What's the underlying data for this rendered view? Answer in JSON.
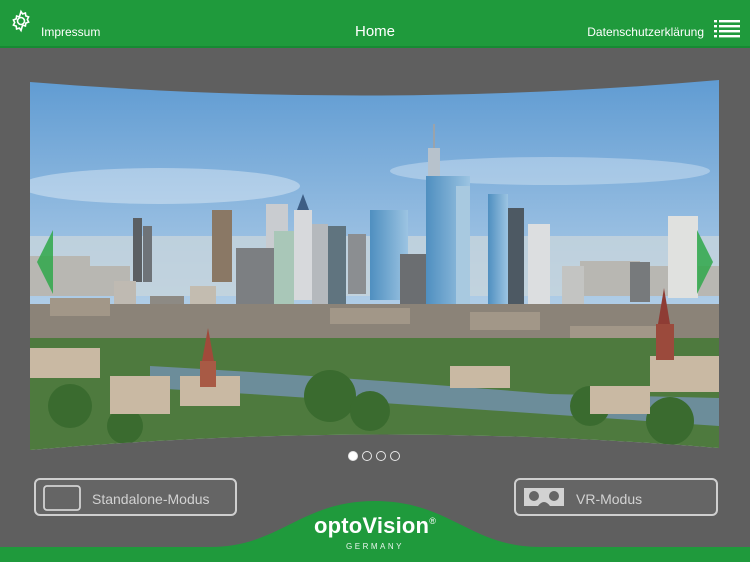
{
  "header": {
    "impressum_label": "Impressum",
    "title": "Home",
    "privacy_label": "Datenschutzerklärung",
    "settings_icon": "gear-icon",
    "menu_icon": "list-menu-icon"
  },
  "carousel": {
    "page_count": 4,
    "active_page": 1
  },
  "modes": {
    "standalone_label": "Standalone-Modus",
    "vr_label": "VR-Modus"
  },
  "brand": {
    "name": "optoVision",
    "registered": "®",
    "subtitle": "GERMANY"
  },
  "colors": {
    "accent": "#1f9a3c",
    "background": "#5f5f5f"
  }
}
